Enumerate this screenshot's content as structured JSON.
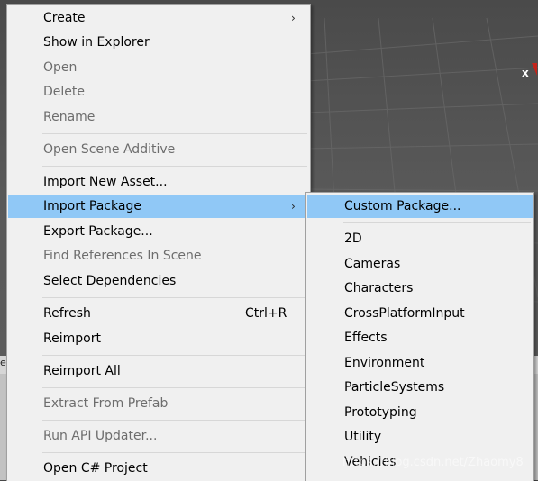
{
  "scene": {
    "gizmo_axis_label": "x"
  },
  "context_menu": {
    "items": [
      {
        "label": "Create",
        "arrow": "›"
      },
      {
        "label": "Show in Explorer"
      },
      {
        "label": "Open"
      },
      {
        "label": "Delete"
      },
      {
        "label": "Rename"
      },
      {
        "label": "Open Scene Additive"
      },
      {
        "label": "Import New Asset..."
      },
      {
        "label": "Import Package",
        "arrow": "›"
      },
      {
        "label": "Export Package..."
      },
      {
        "label": "Find References In Scene"
      },
      {
        "label": "Select Dependencies"
      },
      {
        "label": "Refresh",
        "shortcut": "Ctrl+R"
      },
      {
        "label": "Reimport"
      },
      {
        "label": "Reimport All"
      },
      {
        "label": "Extract From Prefab"
      },
      {
        "label": "Run API Updater..."
      },
      {
        "label": "Open C# Project"
      }
    ]
  },
  "submenu": {
    "items": [
      {
        "label": "Custom Package..."
      },
      {
        "label": "2D"
      },
      {
        "label": "Cameras"
      },
      {
        "label": "Characters"
      },
      {
        "label": "CrossPlatformInput"
      },
      {
        "label": "Effects"
      },
      {
        "label": "Environment"
      },
      {
        "label": "ParticleSystems"
      },
      {
        "label": "Prototyping"
      },
      {
        "label": "Utility"
      },
      {
        "label": "Vehicles"
      }
    ]
  },
  "watermark": "https://blog.csdn.net/Zhaomy8",
  "lower_panel": {
    "edge_text": "e"
  }
}
